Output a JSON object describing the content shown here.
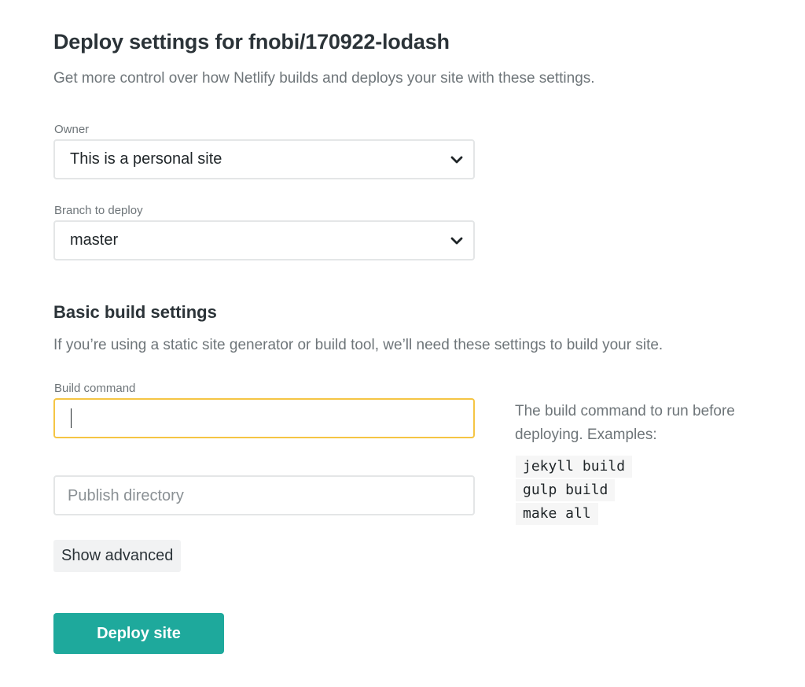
{
  "header": {
    "title": "Deploy settings for fnobi/170922-lodash",
    "subtitle": "Get more control over how Netlify builds and deploys your site with these settings."
  },
  "owner": {
    "label": "Owner",
    "value": "This is a personal site"
  },
  "branch": {
    "label": "Branch to deploy",
    "value": "master"
  },
  "build_settings": {
    "title": "Basic build settings",
    "subtitle": "If you’re using a static site generator or build tool, we’ll need these settings to build your site.",
    "build_command": {
      "label": "Build command",
      "value": ""
    },
    "publish_directory": {
      "placeholder": "Publish directory"
    },
    "help": {
      "text": "The build command to run before deploying. Examples:",
      "examples": [
        "jekyll build",
        "gulp build",
        "make all"
      ]
    },
    "show_advanced_label": "Show advanced"
  },
  "deploy_button_label": "Deploy site",
  "colors": {
    "accent": "#1ea99c",
    "focus_border": "#f5c544"
  },
  "icons": {
    "select_chevron": "chevron-down-icon"
  }
}
